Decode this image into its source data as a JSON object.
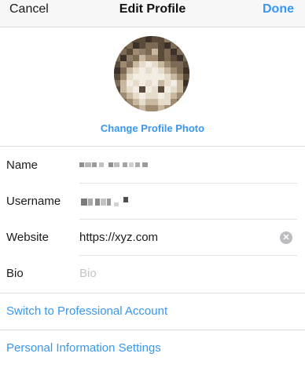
{
  "nav": {
    "cancel_label": "Cancel",
    "title": "Edit Profile",
    "done_label": "Done"
  },
  "profile": {
    "change_photo_label": "Change Profile Photo"
  },
  "fields": {
    "name": {
      "label": "Name",
      "value_obscured": true
    },
    "username": {
      "label": "Username",
      "value_obscured": true
    },
    "website": {
      "label": "Website",
      "value": "https://xyz.com",
      "clear_icon": "clear-circle-icon"
    },
    "bio": {
      "label": "Bio",
      "placeholder": "Bio"
    }
  },
  "links": {
    "professional": "Switch to Professional Account",
    "personal_info": "Personal Information Settings"
  },
  "colors": {
    "accent": "#3897f0",
    "divider": "#dcdcdf",
    "placeholder": "#c4c4c7"
  }
}
